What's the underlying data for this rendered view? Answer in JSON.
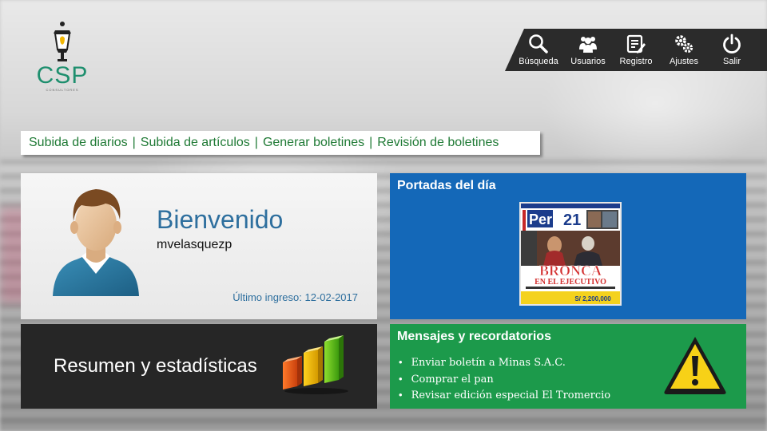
{
  "logo": {
    "text": "CSP",
    "sub": "CONSULTORES"
  },
  "toolbar": {
    "items": [
      {
        "label": "Búsqueda",
        "icon": "search-icon"
      },
      {
        "label": "Usuarios",
        "icon": "users-icon"
      },
      {
        "label": "Registro",
        "icon": "register-icon"
      },
      {
        "label": "Ajustes",
        "icon": "gears-icon"
      },
      {
        "label": "Salir",
        "icon": "power-icon"
      }
    ]
  },
  "nav": {
    "links": [
      "Subida de diarios",
      "Subida de artículos",
      "Generar boletines",
      "Revisión de boletines"
    ],
    "separator": "|"
  },
  "welcome": {
    "title": "Bienvenido",
    "user": "mvelasquezp",
    "last_login": "Último ingreso: 12-02-2017"
  },
  "covers": {
    "title": "Portadas del día",
    "newspaper": {
      "name_left": "Perú",
      "name_right": "21",
      "headline": "BRONCA",
      "subheadline": "EN EL EJECUTIVO",
      "price": "S/ 2,200,000"
    }
  },
  "stats": {
    "title": "Resumen y estadísticas"
  },
  "messages": {
    "title": "Mensajes y recordatorios",
    "items": [
      "Enviar boletín a Minas S.A.C.",
      "Comprar el pan",
      "Revisar edición especial El Tromercio"
    ]
  },
  "colors": {
    "accent_green": "#1f7a35",
    "panel_blue": "#1468b8",
    "panel_green": "#1c9a4b",
    "panel_dark": "#262626",
    "logo_green": "#1e8f6e"
  }
}
